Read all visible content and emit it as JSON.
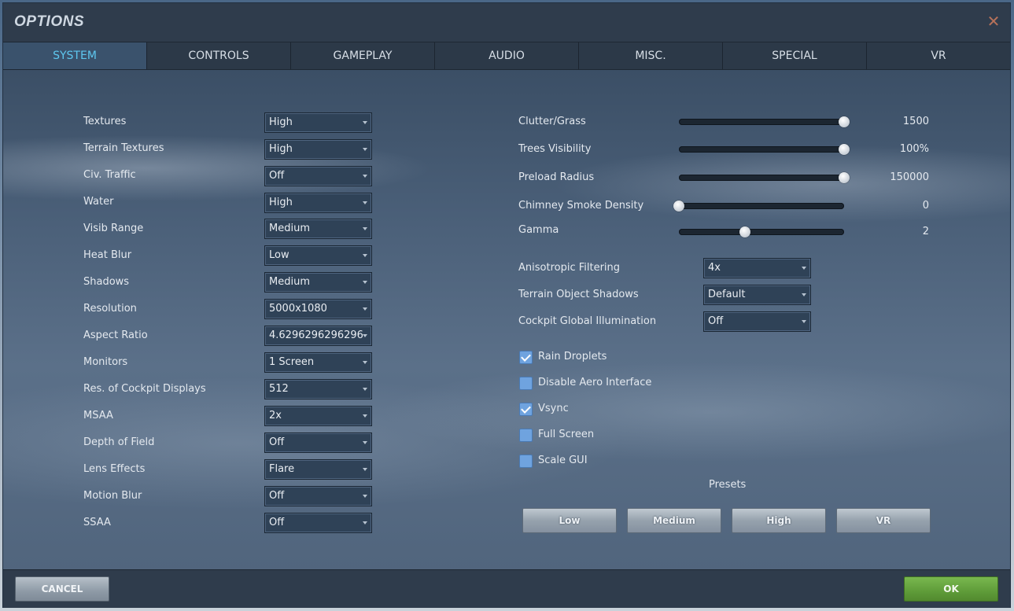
{
  "window": {
    "title": "OPTIONS",
    "close_glyph": "✕"
  },
  "tabs": [
    {
      "label": "SYSTEM",
      "active": true
    },
    {
      "label": "CONTROLS"
    },
    {
      "label": "GAMEPLAY"
    },
    {
      "label": "AUDIO"
    },
    {
      "label": "MISC."
    },
    {
      "label": "SPECIAL"
    },
    {
      "label": "VR"
    }
  ],
  "left_settings": [
    {
      "label": "Textures",
      "value": "High"
    },
    {
      "label": "Terrain Textures",
      "value": "High"
    },
    {
      "label": "Civ. Traffic",
      "value": "Off"
    },
    {
      "label": "Water",
      "value": "High"
    },
    {
      "label": "Visib Range",
      "value": "Medium"
    },
    {
      "label": "Heat Blur",
      "value": "Low"
    },
    {
      "label": "Shadows",
      "value": "Medium"
    },
    {
      "label": "Resolution",
      "value": "5000x1080"
    },
    {
      "label": "Aspect Ratio",
      "value": "4.6296296296296"
    },
    {
      "label": "Monitors",
      "value": "1 Screen"
    },
    {
      "label": "Res. of Cockpit Displays",
      "value": "512"
    },
    {
      "label": "MSAA",
      "value": "2x"
    },
    {
      "label": "Depth of Field",
      "value": "Off"
    },
    {
      "label": "Lens Effects",
      "value": "Flare"
    },
    {
      "label": "Motion Blur",
      "value": "Off"
    },
    {
      "label": "SSAA",
      "value": "Off"
    }
  ],
  "sliders": [
    {
      "label": "Clutter/Grass",
      "value": "1500",
      "fraction": 1.0
    },
    {
      "label": "Trees Visibility",
      "value": "100%",
      "fraction": 1.0
    },
    {
      "label": "Preload Radius",
      "value": "150000",
      "fraction": 1.0
    },
    {
      "label": "Chimney Smoke Density",
      "value": "0",
      "fraction": 0.0
    },
    {
      "label": "Gamma",
      "value": "2",
      "fraction": 0.4
    }
  ],
  "right_dropdowns": [
    {
      "label": "Anisotropic Filtering",
      "value": "4x"
    },
    {
      "label": "Terrain Object Shadows",
      "value": "Default"
    },
    {
      "label": "Cockpit Global Illumination",
      "value": "Off"
    }
  ],
  "checkboxes": [
    {
      "label": "Rain Droplets",
      "checked": true
    },
    {
      "label": "Disable Aero Interface",
      "checked": false
    },
    {
      "label": "Vsync",
      "checked": true
    },
    {
      "label": "Full Screen",
      "checked": false
    },
    {
      "label": "Scale GUI",
      "checked": false
    }
  ],
  "presets": {
    "label": "Presets",
    "buttons": [
      "Low",
      "Medium",
      "High",
      "VR"
    ]
  },
  "footer": {
    "cancel_label": "CANCEL",
    "ok_label": "OK"
  },
  "colors": {
    "active_tab_text": "#5ec7ef",
    "checkbox_fill": "#6fa3df",
    "ok_green": "#5f9c39",
    "close_x": "#b7725a"
  },
  "icons": {
    "close": "close-icon",
    "dropdown_arrow": "chevron-down-icon",
    "checkmark": "checkmark-icon"
  }
}
